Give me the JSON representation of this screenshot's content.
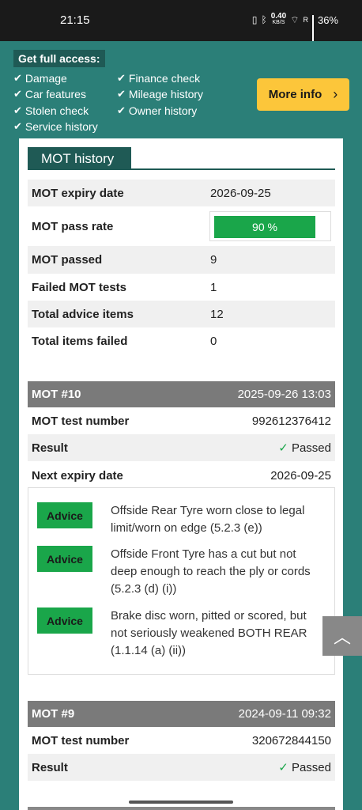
{
  "status_bar": {
    "time": "21:15",
    "data_speed": "0.40",
    "data_unit": "KB/S",
    "roaming": "R",
    "battery": "36%"
  },
  "promo": {
    "title": "Get full access:",
    "features_col1": [
      "Damage",
      "Car features",
      "Stolen check",
      "Service history"
    ],
    "features_col2": [
      "Finance check",
      "Mileage history",
      "Owner history"
    ],
    "more_info_label": "More info"
  },
  "mot_history": {
    "section_title": "MOT history",
    "summary": [
      {
        "label": "MOT expiry date",
        "value": "2026-09-25"
      },
      {
        "label": "MOT pass rate",
        "value": "90 %"
      },
      {
        "label": "MOT passed",
        "value": "9"
      },
      {
        "label": "Failed MOT tests",
        "value": "1"
      },
      {
        "label": "Total advice items",
        "value": "12"
      },
      {
        "label": "Total items failed",
        "value": "0"
      }
    ],
    "pass_rate_fraction": 0.9
  },
  "mot10": {
    "title": "MOT #10",
    "datetime": "2025-09-26 13:03",
    "test_number_label": "MOT test number",
    "test_number": "992612376412",
    "result_label": "Result",
    "result": "Passed",
    "expiry_label": "Next expiry date",
    "expiry": "2026-09-25",
    "advice": [
      {
        "badge": "Advice",
        "lines": [
          "Offside Rear Tyre worn close to legal",
          "limit/worn on edge (5.2.3 (e))"
        ]
      },
      {
        "badge": "Advice",
        "lines": [
          "Offside Front Tyre has a cut but not",
          "deep enough to reach the ply or cords",
          "(5.2.3 (d) (i))"
        ]
      },
      {
        "badge": "Advice",
        "lines": [
          "Brake disc worn, pitted or scored, but",
          "not seriously weakened BOTH REAR",
          "(1.1.14 (a) (ii))"
        ]
      }
    ]
  },
  "mot9": {
    "title": "MOT #9",
    "datetime": "2024-09-11 09:32",
    "test_number_label": "MOT test number",
    "test_number": "320672844150",
    "result_label": "Result",
    "result": "Passed"
  },
  "colors": {
    "brand_teal": "#2b7f78",
    "dark_teal": "#1f5a55",
    "accent_yellow": "#fcc63a",
    "pass_green": "#1aa64a"
  }
}
